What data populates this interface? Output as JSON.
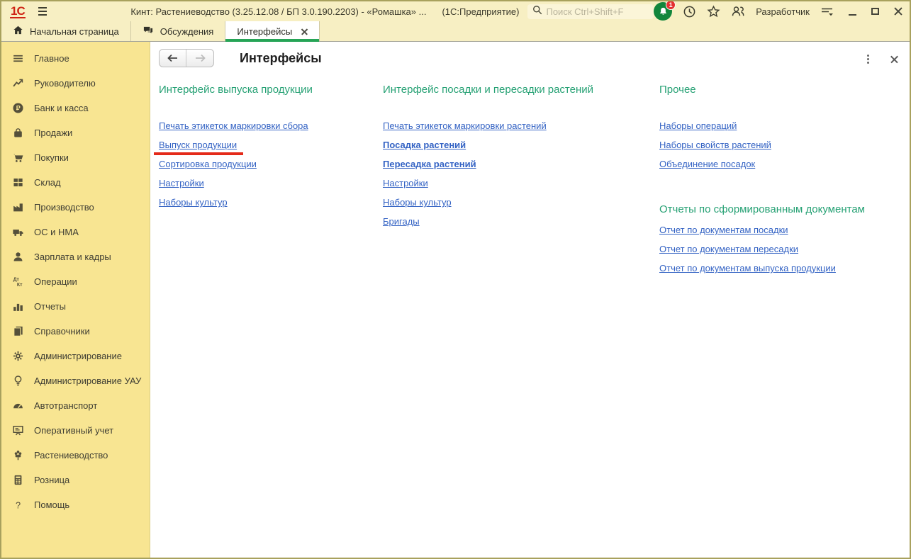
{
  "titlebar": {
    "logo": "1С",
    "title": "Кинт: Растениеводство (3.25.12.08 / БП 3.0.190.2203) - «Ромашка» ...",
    "app_name": "(1С:Предприятие)",
    "search_placeholder": "Поиск Ctrl+Shift+F",
    "notification_count": "1",
    "user_role": "Разработчик"
  },
  "tabs": [
    {
      "label": "Начальная страница",
      "icon": "home-icon"
    },
    {
      "label": "Обсуждения",
      "icon": "chat-icon"
    },
    {
      "label": "Интерфейсы",
      "active": true,
      "closable": true
    }
  ],
  "sidebar": {
    "items": [
      {
        "label": "Главное",
        "icon": "main-menu-icon"
      },
      {
        "label": "Руководителю",
        "icon": "manager-trend-icon"
      },
      {
        "label": "Банк и касса",
        "icon": "ruble-coin-icon"
      },
      {
        "label": "Продажи",
        "icon": "sales-bag-icon"
      },
      {
        "label": "Покупки",
        "icon": "purchases-cart-icon"
      },
      {
        "label": "Склад",
        "icon": "warehouse-grid-icon"
      },
      {
        "label": "Производство",
        "icon": "production-factory-icon"
      },
      {
        "label": "ОС и НМА",
        "icon": "assets-truck-icon"
      },
      {
        "label": "Зарплата и кадры",
        "icon": "salary-person-icon"
      },
      {
        "label": "Операции",
        "icon": "operations-dtkt-icon"
      },
      {
        "label": "Отчеты",
        "icon": "reports-barchart-icon"
      },
      {
        "label": "Справочники",
        "icon": "catalogs-books-icon"
      },
      {
        "label": "Администрирование",
        "icon": "administration-gear-icon"
      },
      {
        "label": "Администрирование УАУ",
        "icon": "admin-uau-bulb-icon"
      },
      {
        "label": "Автотранспорт",
        "icon": "transport-speedometer-icon"
      },
      {
        "label": "Оперативный учет",
        "icon": "operational-board-icon"
      },
      {
        "label": "Растениеводство",
        "icon": "crop-plant-icon"
      },
      {
        "label": "Розница",
        "icon": "retail-calculator-icon"
      },
      {
        "label": "Помощь",
        "icon": "help-question-icon"
      }
    ]
  },
  "main": {
    "title": "Интерфейсы",
    "sections": [
      {
        "heading": "Интерфейс выпуска продукции",
        "links": [
          {
            "label": "Печать этикеток маркировки сбора"
          },
          {
            "label": "Выпуск продукции",
            "annotated": true
          },
          {
            "label": "Сортировка продукции"
          },
          {
            "label": "Настройки"
          },
          {
            "label": "Наборы культур"
          }
        ]
      },
      {
        "heading": "Интерфейс посадки и пересадки растений",
        "links": [
          {
            "label": "Печать этикеток маркировки растений"
          },
          {
            "label": "Посадка растений",
            "bold": true
          },
          {
            "label": "Пересадка растений",
            "bold": true
          },
          {
            "label": "Настройки"
          },
          {
            "label": "Наборы культур"
          },
          {
            "label": "Бригады"
          }
        ]
      },
      {
        "heading": "Прочее",
        "links": [
          {
            "label": "Наборы операций"
          },
          {
            "label": "Наборы свойств растений"
          },
          {
            "label": "Объединение посадок"
          }
        ]
      },
      {
        "heading": "Отчеты по сформированным документам",
        "links": [
          {
            "label": "Отчет по документам посадки"
          },
          {
            "label": "Отчет по документам пересадки"
          },
          {
            "label": "Отчет по документам выпуска продукции"
          }
        ]
      }
    ]
  },
  "colors": {
    "titlebar_yellow": "#f7efc3",
    "sidebar_yellow": "#f8e592",
    "accent_green": "#26a456",
    "heading_green": "#26a174",
    "link_blue": "#3463c4",
    "annotation_red": "#e42a1a",
    "bell_green": "#12863c",
    "badge_red": "#e53030"
  }
}
